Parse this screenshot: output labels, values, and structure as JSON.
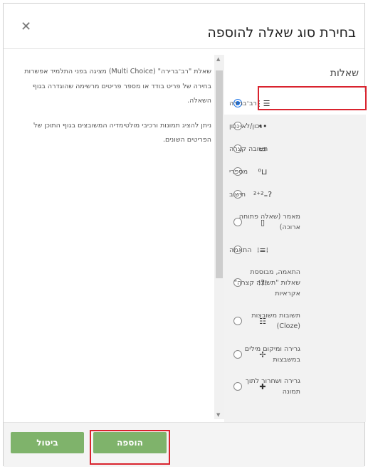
{
  "dialog": {
    "title": "בחירת סוג שאלה להוספה",
    "close_icon": "close-icon"
  },
  "list": {
    "title": "שאלות",
    "items": [
      {
        "label": "רב־ברירה",
        "icon": "multichoice-icon",
        "glyph": "⋮☰",
        "selected": true
      },
      {
        "label": "נכון/לא-נכון",
        "icon": "truefalse-icon",
        "glyph": "••",
        "selected": false
      },
      {
        "label": "תשובה קצרה",
        "icon": "shortanswer-icon",
        "glyph": "▭",
        "selected": false
      },
      {
        "label": "מספרי",
        "icon": "numerical-icon",
        "glyph": "⁰⊔",
        "selected": false
      },
      {
        "label": "חישוב",
        "icon": "calculated-icon",
        "glyph": "²⁺²₌?",
        "selected": false
      },
      {
        "label": "מאמר (שאלה פתוחה ארוכה)",
        "icon": "essay-icon",
        "glyph": "▯",
        "selected": false
      },
      {
        "label": "התאמה",
        "icon": "match-icon",
        "glyph": "⁝≡⁝",
        "selected": false
      },
      {
        "label": "התאמה, מבוססת שאלות \"תשובה קצרה\" אקראיות",
        "icon": "randomsamatch-icon",
        "glyph": "⁝?⁝",
        "selected": false
      },
      {
        "label": "תשובות משובצות (Cloze)",
        "icon": "cloze-icon",
        "glyph": "☷",
        "selected": false
      },
      {
        "label": "גרירה ומיקום מילים במשבצות",
        "icon": "ddwtos-icon",
        "glyph": "✢",
        "selected": false
      },
      {
        "label": "גרירה ושחרור לתוך תמונה",
        "icon": "ddimage-icon",
        "glyph": "✚",
        "selected": false
      }
    ]
  },
  "description": {
    "p1": "שאלת \"רב־ברירה\" (Multi Choice) מציגה בפני התלמיד אפשרות בחירה של פריט בודד או מספר פריטים מרשימה שהוגדרה בגוף השאלה.",
    "p2": "ניתן להציג תמונות ורכיבי מולטימדיה המשובצים בגוף התוכן של הפריטים השונים."
  },
  "footer": {
    "add_label": "הוספה",
    "cancel_label": "ביטול"
  },
  "colors": {
    "button": "#7fb36b",
    "highlight": "#d9232e",
    "radio_selected": "#1a73e8"
  }
}
